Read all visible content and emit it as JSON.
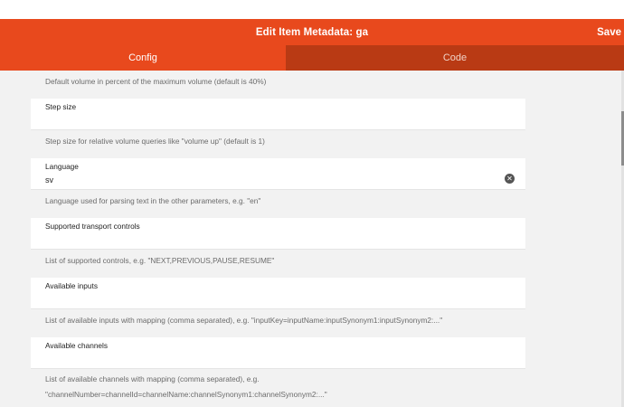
{
  "header": {
    "title": "Edit Item Metadata: ga",
    "save_label": "Save"
  },
  "tabs": [
    {
      "label": "Config",
      "active": true
    },
    {
      "label": "Code",
      "active": false
    }
  ],
  "hints": {
    "volume": "Default volume in percent of the maximum volume (default is 40%)",
    "step_size": "Step size for relative volume queries like \"volume up\" (default is 1)",
    "language": "Language used for parsing text in the other parameters, e.g. \"en\"",
    "transport": "List of supported controls, e.g. \"NEXT,PREVIOUS,PAUSE,RESUME\"",
    "inputs": "List of available inputs with mapping (comma separated), e.g. \"inputKey=inputName:inputSynonym1:inputSynonym2:...\"",
    "channels_1": "List of available channels with mapping (comma separated), e.g.",
    "channels_2": "\"channelNumber=channelId=channelName:channelSynonym1:channelSynonym2:...\""
  },
  "fields": {
    "step_size": {
      "label": "Step size",
      "value": ""
    },
    "language": {
      "label": "Language",
      "value": "sv"
    },
    "transport": {
      "label": "Supported transport controls",
      "value": ""
    },
    "inputs": {
      "label": "Available inputs",
      "value": ""
    },
    "channels": {
      "label": "Available channels",
      "value": ""
    }
  },
  "icons": {
    "clear": "close-circle-icon"
  },
  "colors": {
    "accent": "#e8491d",
    "tab_inactive": "#b93a14"
  }
}
